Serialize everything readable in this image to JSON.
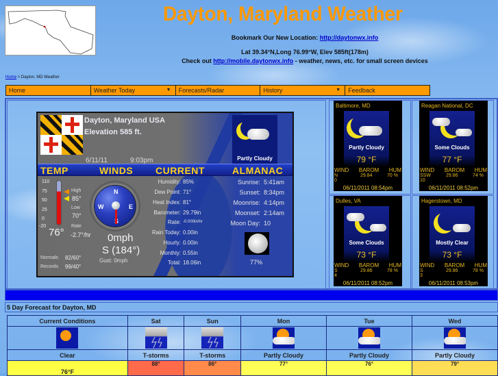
{
  "header": {
    "title": "Dayton, Maryland Weather",
    "bookmark_prefix": "Bookmark Our New Location: ",
    "bookmark_link": "http://daytonwx.info",
    "coords": "Lat 39.34°N,Long 76.99°W, Elev 585ft(178m)",
    "mobile_prefix": "Check out ",
    "mobile_link": "http://mobile.daytonwx.info",
    "mobile_suffix": " - weather, news, etc. for small screen devices"
  },
  "breadcrumb": {
    "home": "Home",
    "sep": " > ",
    "current": "Dayton, MD Weather"
  },
  "nav": [
    {
      "label": "Home",
      "dropdown": false
    },
    {
      "label": "Weather Today",
      "dropdown": true
    },
    {
      "label": "Forecasts/Radar",
      "dropdown": false
    },
    {
      "label": "History",
      "dropdown": true
    },
    {
      "label": "Feedback",
      "dropdown": false
    }
  ],
  "sticker": {
    "title": "Dayton, Maryland USA",
    "elevation": "Elevation 585 ft.",
    "date": "6/11/11",
    "time": "9:03pm",
    "condition": "Partly Cloudy",
    "headers": {
      "temp": "TEMP",
      "winds": "WINDS",
      "current": "CURRENT",
      "almanac": "ALMANAC"
    },
    "temp": {
      "scale": [
        "110",
        "75",
        "50",
        "25",
        "0",
        "-20"
      ],
      "high_label": "High",
      "high": "85°",
      "low_label": "Low",
      "low": "70°",
      "rate_label": "Rate",
      "rate": "-2.7°/hr",
      "current": "76°",
      "normals_label": "Normals",
      "normals": "82/60°",
      "records_label": "Records",
      "records": "99/40°"
    },
    "wind": {
      "compass": {
        "n": "N",
        "e": "E",
        "s": "S",
        "w": "W"
      },
      "speed": "0mph",
      "direction": "S (184°)",
      "gust": "Gust: 0mph"
    },
    "current": [
      {
        "label": "Humidity:",
        "value": "85%"
      },
      {
        "label": "Dew Point:",
        "value": "71°"
      },
      {
        "label": "Heat Index:",
        "value": "81°"
      },
      {
        "label": "Barometer:",
        "value": "29.79in"
      },
      {
        "label": "Rate:",
        "value": "-0.000in/hr"
      },
      {
        "label": "Rain Today:",
        "value": "0.00in"
      },
      {
        "label": "Hourly:",
        "value": "0.00in"
      },
      {
        "label": "Monthly:",
        "value": "0.55in"
      },
      {
        "label": "Total:",
        "value": "18.06in"
      }
    ],
    "almanac": [
      {
        "label": "Sunrise:",
        "value": "5:41am"
      },
      {
        "label": "Sunset:",
        "value": "8:34pm"
      },
      {
        "label": "Moonrise:",
        "value": "4:14pm"
      },
      {
        "label": "Moonset:",
        "value": "2:14am"
      },
      {
        "label": "Moon Day:",
        "value": "10"
      }
    ],
    "moon_pct": "77%"
  },
  "stations": [
    {
      "name": "Baltimore, MD",
      "condition": "Partly Cloudy",
      "temp": "79 °F",
      "wind_dir": "N",
      "wind_speed": "0",
      "barom": "29.84",
      "hum": "70 %",
      "time": "06/11/2011 08:54pm"
    },
    {
      "name": "Reagan National, DC",
      "condition": "Some Clouds",
      "temp": "77 °F",
      "wind_dir": "SSW",
      "wind_speed": "10",
      "barom": "29.86",
      "hum": "74 %",
      "time": "06/11/2011 08:52pm"
    },
    {
      "name": "Dulles, VA",
      "condition": "Some Clouds",
      "temp": "73 °F",
      "wind_dir": "S",
      "wind_speed": "4",
      "barom": "29.86",
      "hum": "78 %",
      "time": "06/11/2011 08:52pm"
    },
    {
      "name": "Hagerstown, MD",
      "condition": "Mostly Clear",
      "temp": "73 °F",
      "wind_dir": "S",
      "wind_speed": "3",
      "barom": "29.86",
      "hum": "78 %",
      "time": "06/11/2011 08:53pm"
    }
  ],
  "station_headers": {
    "wind": "WIND",
    "barom": "BAROM",
    "hum": "HUM"
  },
  "forecast": {
    "title": "5 Day Forecast for Dayton, MD",
    "columns": [
      {
        "day": "Current Conditions",
        "icon": "clear-icon",
        "condition": "Clear",
        "temp": "76°F",
        "color": "#ffff44"
      },
      {
        "day": "Sat",
        "icon": "thunderstorm-icon",
        "condition": "T-storms",
        "temp": "88°",
        "color": "#ff6a4a"
      },
      {
        "day": "Sun",
        "icon": "thunderstorm-icon",
        "condition": "T-storms",
        "temp": "86°",
        "color": "#ff8a4a"
      },
      {
        "day": "Mon",
        "icon": "partly-cloudy-icon",
        "condition": "Partly Cloudy",
        "temp": "77°",
        "color": "#ffff55"
      },
      {
        "day": "Tue",
        "icon": "partly-cloudy-icon",
        "condition": "Partly Cloudy",
        "temp": "76°",
        "color": "#ffff55"
      },
      {
        "day": "Wed",
        "icon": "partly-cloudy-icon",
        "condition": "Partly Cloudy",
        "temp": "79°",
        "color": "#ffdd55"
      }
    ]
  }
}
